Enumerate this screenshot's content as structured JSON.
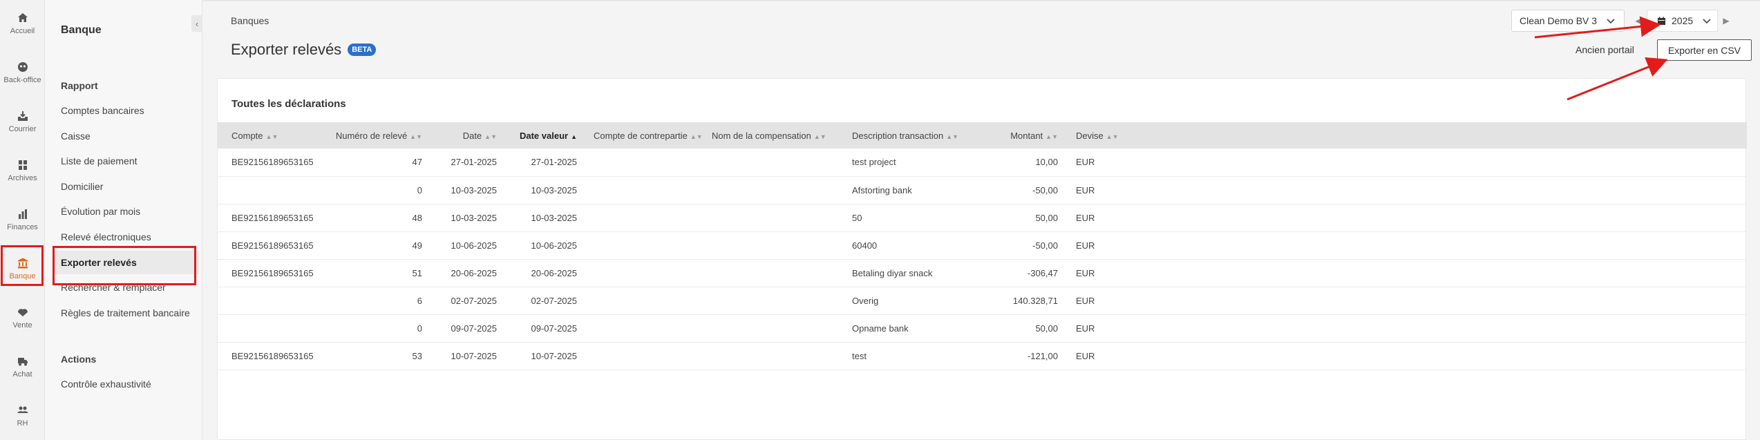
{
  "rail": [
    {
      "label": "Accueil",
      "icon": "home-icon"
    },
    {
      "label": "Back-office",
      "icon": "back-office-icon"
    },
    {
      "label": "Courrier",
      "icon": "inbox-icon"
    },
    {
      "label": "Archives",
      "icon": "archive-icon"
    },
    {
      "label": "Finances",
      "icon": "chart-icon"
    },
    {
      "label": "Banque",
      "icon": "bank-icon",
      "active": true
    },
    {
      "label": "Vente",
      "icon": "sale-icon"
    },
    {
      "label": "Achat",
      "icon": "truck-icon"
    },
    {
      "label": "RH",
      "icon": "people-icon"
    }
  ],
  "subnav": {
    "title": "Banque",
    "report_section": "Rapport",
    "report_items": [
      "Comptes bancaires",
      "Caisse",
      "Liste de paiement",
      "Domicilier",
      "Évolution par mois",
      "Relevé électroniques",
      "Exporter relevés",
      "Rechercher & remplacer",
      "Règles de traitement bancaire"
    ],
    "actions_section": "Actions",
    "action_items": [
      "Contrôle exhaustivité"
    ]
  },
  "header": {
    "breadcrumb": "Banques",
    "title": "Exporter relevés",
    "badge": "BETA",
    "company": "Clean Demo BV 3",
    "year": "2025",
    "old_portal": "Ancien portail",
    "export_button": "Exporter en CSV"
  },
  "card": {
    "title": "Toutes les déclarations"
  },
  "table": {
    "columns": [
      "Compte",
      "Numéro de relevé",
      "Date",
      "Date valeur",
      "Compte de contrepartie",
      "Nom de la compensation",
      "Description transaction",
      "Montant",
      "Devise"
    ],
    "rows": [
      {
        "compte": "BE92156189653165",
        "numero": "47",
        "date": "27-01-2025",
        "date_valeur": "27-01-2025",
        "contrepartie": "",
        "compensation": "",
        "description": "test project",
        "montant": "10,00",
        "devise": "EUR"
      },
      {
        "compte": "",
        "numero": "0",
        "date": "10-03-2025",
        "date_valeur": "10-03-2025",
        "contrepartie": "",
        "compensation": "",
        "description": "Afstorting bank",
        "montant": "-50,00",
        "devise": "EUR"
      },
      {
        "compte": "BE92156189653165",
        "numero": "48",
        "date": "10-03-2025",
        "date_valeur": "10-03-2025",
        "contrepartie": "",
        "compensation": "",
        "description": "50",
        "montant": "50,00",
        "devise": "EUR"
      },
      {
        "compte": "BE92156189653165",
        "numero": "49",
        "date": "10-06-2025",
        "date_valeur": "10-06-2025",
        "contrepartie": "",
        "compensation": "",
        "description": "60400",
        "montant": "-50,00",
        "devise": "EUR"
      },
      {
        "compte": "BE92156189653165",
        "numero": "51",
        "date": "20-06-2025",
        "date_valeur": "20-06-2025",
        "contrepartie": "",
        "compensation": "",
        "description": "Betaling diyar snack",
        "montant": "-306,47",
        "devise": "EUR"
      },
      {
        "compte": "",
        "numero": "6",
        "date": "02-07-2025",
        "date_valeur": "02-07-2025",
        "contrepartie": "",
        "compensation": "",
        "description": "Overig",
        "montant": "140.328,71",
        "devise": "EUR"
      },
      {
        "compte": "",
        "numero": "0",
        "date": "09-07-2025",
        "date_valeur": "09-07-2025",
        "contrepartie": "",
        "compensation": "",
        "description": "Opname bank",
        "montant": "50,00",
        "devise": "EUR"
      },
      {
        "compte": "BE92156189653165",
        "numero": "53",
        "date": "10-07-2025",
        "date_valeur": "10-07-2025",
        "contrepartie": "",
        "compensation": "",
        "description": "test",
        "montant": "-121,00",
        "devise": "EUR"
      }
    ]
  },
  "colors": {
    "accent_active": "#e06a1a",
    "badge": "#2a6fc9",
    "annotation": "#e31b1b"
  }
}
